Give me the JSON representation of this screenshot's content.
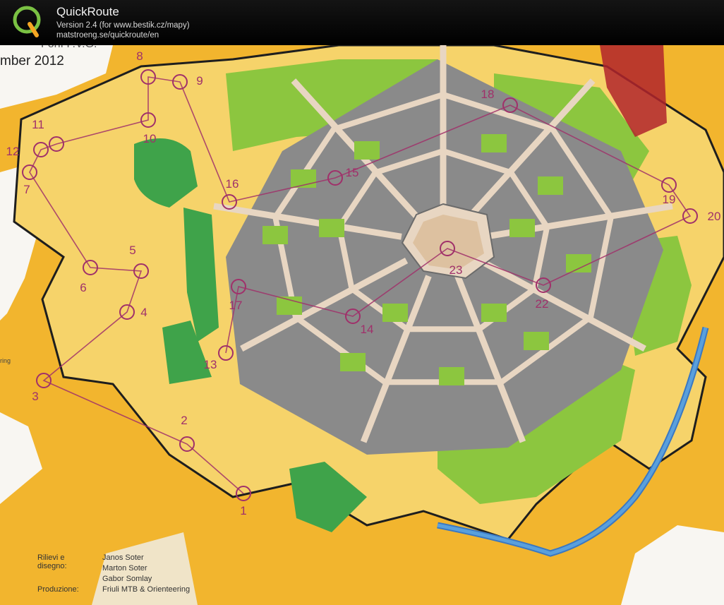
{
  "app": {
    "name": "QuickRoute",
    "version": "Version 2.4  (for www.bestik.cz/mapy)",
    "url": "matstroeng.se/quickroute/en"
  },
  "map": {
    "title_fragment": "Forlì F.V.G.",
    "date_fragment": "mber 2012",
    "edge_label": "ring",
    "controls": [
      {
        "num": "1"
      },
      {
        "num": "2"
      },
      {
        "num": "3"
      },
      {
        "num": "4"
      },
      {
        "num": "5"
      },
      {
        "num": "6"
      },
      {
        "num": "7"
      },
      {
        "num": "8"
      },
      {
        "num": "9"
      },
      {
        "num": "10"
      },
      {
        "num": "11"
      },
      {
        "num": "12"
      },
      {
        "num": "13"
      },
      {
        "num": "14"
      },
      {
        "num": "15"
      },
      {
        "num": "16"
      },
      {
        "num": "17"
      },
      {
        "num": "18"
      },
      {
        "num": "19"
      },
      {
        "num": "20"
      },
      {
        "num": "22"
      },
      {
        "num": "23"
      }
    ],
    "credits": [
      {
        "label": "Rilievi e disegno:",
        "value": "Janos Soter"
      },
      {
        "label": "",
        "value": "Marton Soter"
      },
      {
        "label": "",
        "value": "Gabor Somlay"
      },
      {
        "label": "Produzione:",
        "value": "Friuli MTB & Orienteering"
      }
    ]
  },
  "colors": {
    "open_land": "#f2b52e",
    "rough_open": "#f6d36a",
    "green": "#8cc63f",
    "dark_green": "#3fa34a",
    "building": "#8a8a8a",
    "paved": "#e8d6c2",
    "course": "#a0306a",
    "water": "#5aa0dc",
    "restricted": "#b2242c"
  }
}
